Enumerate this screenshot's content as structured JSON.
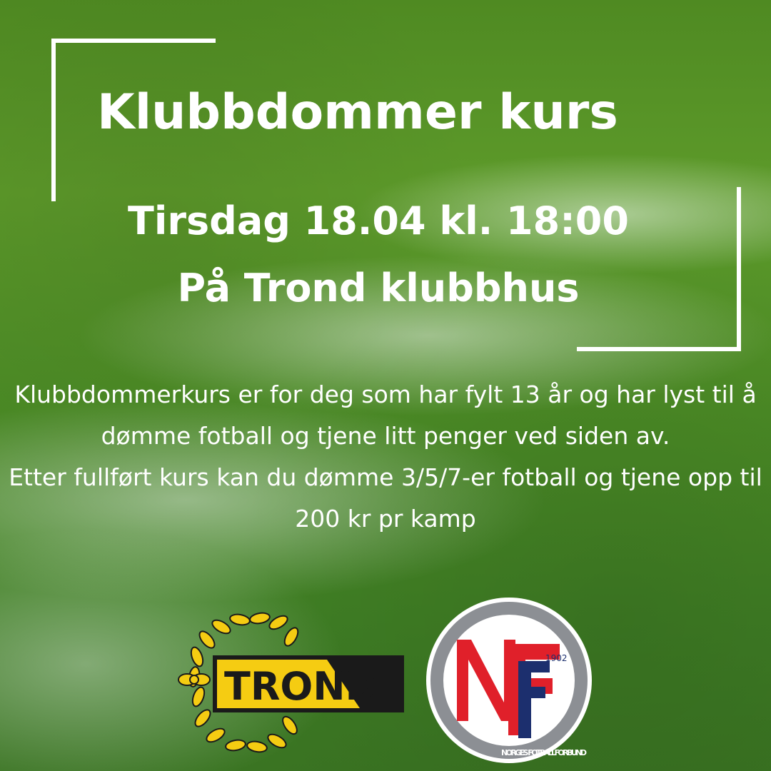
{
  "headline": "Klubbdommer kurs",
  "event": {
    "date_time": "Tirsdag 18.04 kl. 18:00",
    "location": "På Trond klubbhus"
  },
  "description": {
    "line1": "Klubbdommerkurs er for deg som har fylt 13 år og har lyst til å dømme fotball og tjene litt penger ved siden av.",
    "line2": "Etter fullført kurs kan du dømme 3/5/7-er fotball og tjene opp til 200 kr pr kamp"
  },
  "logos": {
    "trond": {
      "text": "TROND"
    },
    "nff": {
      "letters": "NFF",
      "year": "1902",
      "ring_text": "NORGES FOTBALLFORBUND"
    }
  },
  "colors": {
    "text": "#ffffff",
    "trond_yellow": "#f5cc12",
    "trond_black": "#1a1a1a",
    "nff_red": "#e0202a",
    "nff_blue": "#1c2f6e",
    "nff_grey": "#8c8f94"
  }
}
